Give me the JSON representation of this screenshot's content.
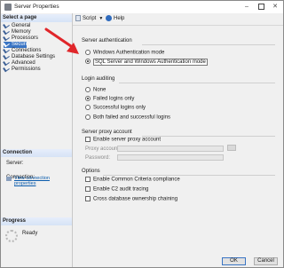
{
  "window": {
    "title": "Server Properties"
  },
  "left_panel": {
    "select_page_header": "Select a page",
    "pages": [
      {
        "label": "General",
        "selected": false
      },
      {
        "label": "Memory",
        "selected": false
      },
      {
        "label": "Processors",
        "selected": false
      },
      {
        "label": "Security",
        "selected": true
      },
      {
        "label": "Connections",
        "selected": false
      },
      {
        "label": "Database Settings",
        "selected": false
      },
      {
        "label": "Advanced",
        "selected": false
      },
      {
        "label": "Permissions",
        "selected": false
      }
    ],
    "connection_header": "Connection",
    "server_label": "Server:",
    "connection_label": "Connection:",
    "view_connection_properties": "View connection properties",
    "progress_header": "Progress",
    "progress_status": "Ready"
  },
  "toolbar": {
    "script_label": "Script",
    "help_label": "Help"
  },
  "server_authentication": {
    "label": "Server authentication",
    "options": [
      {
        "label": "Windows Authentication mode",
        "checked": false
      },
      {
        "label": "SQL Server and Windows Authentication mode",
        "checked": true
      }
    ]
  },
  "login_auditing": {
    "label": "Login auditing",
    "options": [
      {
        "label": "None",
        "checked": false
      },
      {
        "label": "Failed logins only",
        "checked": true
      },
      {
        "label": "Successful logins only",
        "checked": false
      },
      {
        "label": "Both failed and successful logins",
        "checked": false
      }
    ]
  },
  "server_proxy_account": {
    "label": "Server proxy account",
    "enable_label": "Enable server proxy account",
    "proxy_account_label": "Proxy account:",
    "password_label": "Password:",
    "proxy_account_value": "",
    "password_value": ""
  },
  "options": {
    "label": "Options",
    "items": [
      {
        "label": "Enable Common Criteria compliance",
        "checked": false
      },
      {
        "label": "Enable C2 audit tracing",
        "checked": false
      },
      {
        "label": "Cross database ownership chaining",
        "checked": false
      }
    ]
  },
  "buttons": {
    "ok": "OK",
    "cancel": "Cancel"
  },
  "colors": {
    "accent": "#3a75c4",
    "annotation_arrow": "#e0262a",
    "link": "#0b5cad"
  }
}
